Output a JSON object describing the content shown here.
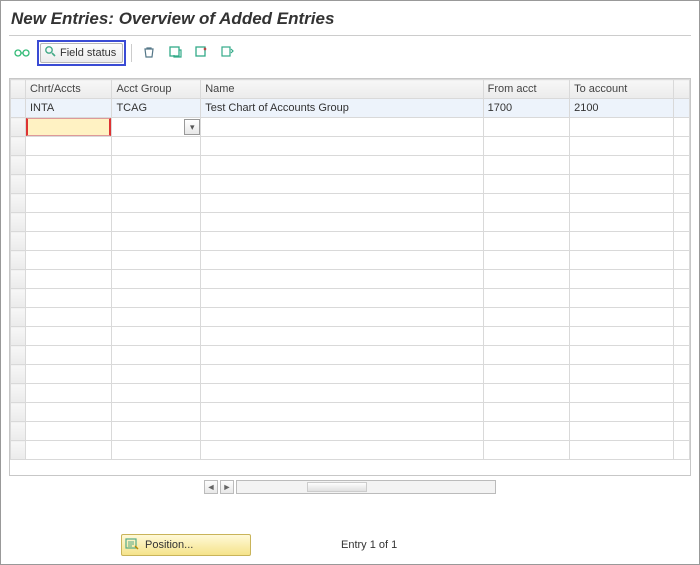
{
  "title": "New Entries: Overview of Added Entries",
  "toolbar": {
    "field_status_label": "Field status"
  },
  "table": {
    "headers": {
      "chart": "Chrt/Accts",
      "acct_group": "Acct Group",
      "name": "Name",
      "from": "From acct",
      "to": "To account"
    },
    "rows": [
      {
        "chart": "INTA",
        "acct_group": "TCAG",
        "name": "Test Chart of Accounts Group",
        "from": "1700",
        "to": "2100"
      }
    ]
  },
  "footer": {
    "position_label": "Position...",
    "entry_label": "Entry 1 of 1"
  }
}
